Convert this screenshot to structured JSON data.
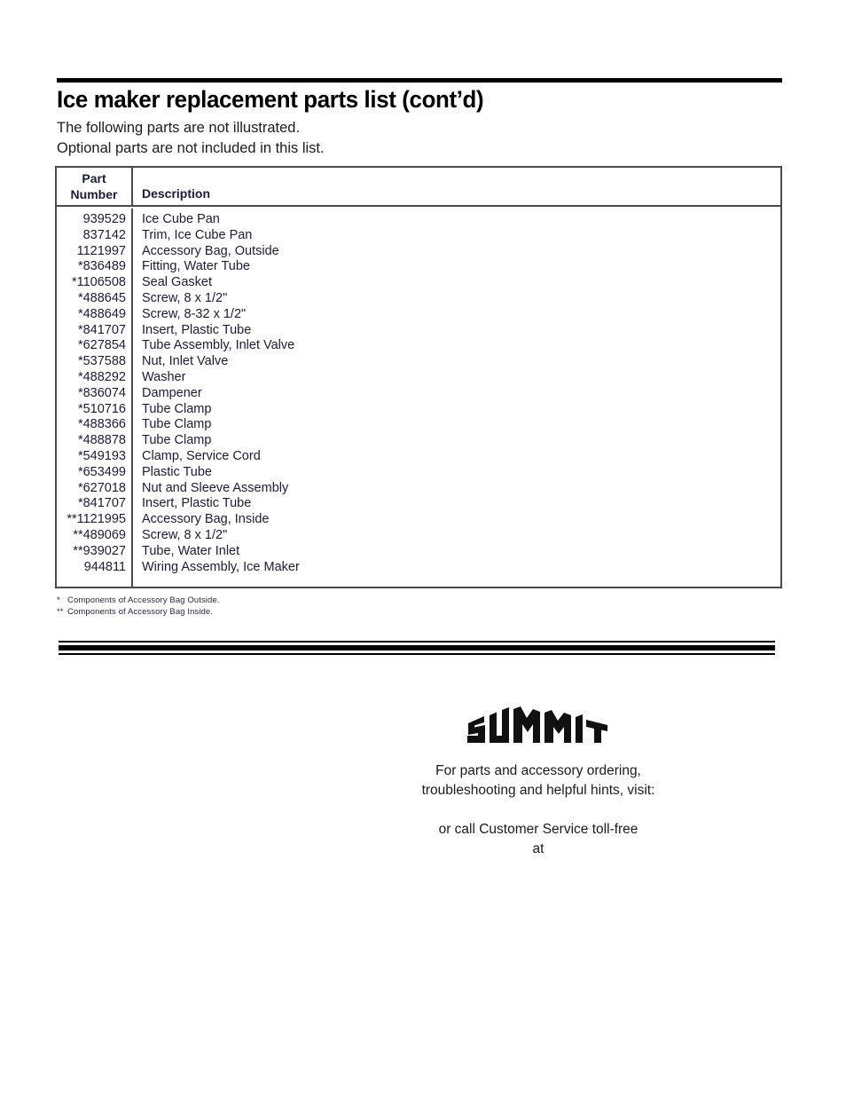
{
  "document": {
    "title": "Ice maker replacement parts list (cont’d)",
    "subtitle_1": "The following parts are not illustrated.",
    "subtitle_2": "Optional parts are not included in this list."
  },
  "table": {
    "headers": {
      "part_number_line1": "Part",
      "part_number_line2": "Number",
      "description": "Description"
    },
    "rows": [
      {
        "part": "939529",
        "desc": "Ice Cube Pan"
      },
      {
        "part": "837142",
        "desc": "Trim, Ice Cube Pan"
      },
      {
        "part": "1121997",
        "desc": "Accessory Bag, Outside"
      },
      {
        "part": "*836489",
        "desc": "Fitting, Water Tube"
      },
      {
        "part": "*1106508",
        "desc": "Seal Gasket"
      },
      {
        "part": "*488645",
        "desc": "Screw, 8 x 1/2\""
      },
      {
        "part": "*488649",
        "desc": "Screw, 8-32 x 1/2\""
      },
      {
        "part": "*841707",
        "desc": "Insert, Plastic Tube"
      },
      {
        "part": "*627854",
        "desc": "Tube Assembly, Inlet Valve"
      },
      {
        "part": "*537588",
        "desc": "Nut, Inlet Valve"
      },
      {
        "part": "*488292",
        "desc": "Washer"
      },
      {
        "part": "*836074",
        "desc": "Dampener"
      },
      {
        "part": "*510716",
        "desc": "Tube Clamp"
      },
      {
        "part": "*488366",
        "desc": "Tube Clamp"
      },
      {
        "part": "*488878",
        "desc": "Tube Clamp"
      },
      {
        "part": "*549193",
        "desc": "Clamp, Service Cord"
      },
      {
        "part": "*653499",
        "desc": "Plastic Tube"
      },
      {
        "part": "*627018",
        "desc": "Nut and Sleeve Assembly"
      },
      {
        "part": "*841707",
        "desc": "Insert, Plastic Tube"
      },
      {
        "part": "**1121995",
        "desc": "Accessory Bag, Inside"
      },
      {
        "part": "**489069",
        "desc": "Screw, 8 x 1/2\""
      },
      {
        "part": "**939027",
        "desc": "Tube, Water Inlet"
      },
      {
        "part": "944811",
        "desc": "Wiring Assembly, Ice Maker"
      }
    ]
  },
  "footnotes": [
    {
      "mark": "*",
      "text": "Components of Accessory Bag Outside."
    },
    {
      "mark": "**",
      "text": "Components of Accessory Bag Inside."
    }
  ],
  "brand": {
    "name": "SUMMIT"
  },
  "footer": {
    "line_1": "For parts and accessory ordering,",
    "line_2": "troubleshooting and helpful hints, visit:",
    "line_3": "",
    "line_4": "or call Customer Service toll-free",
    "line_5": "at",
    "line_6": ""
  },
  "colors": {
    "rule": "#000000",
    "table_border": "#4b4b4f",
    "text": "#1b1b3a"
  }
}
